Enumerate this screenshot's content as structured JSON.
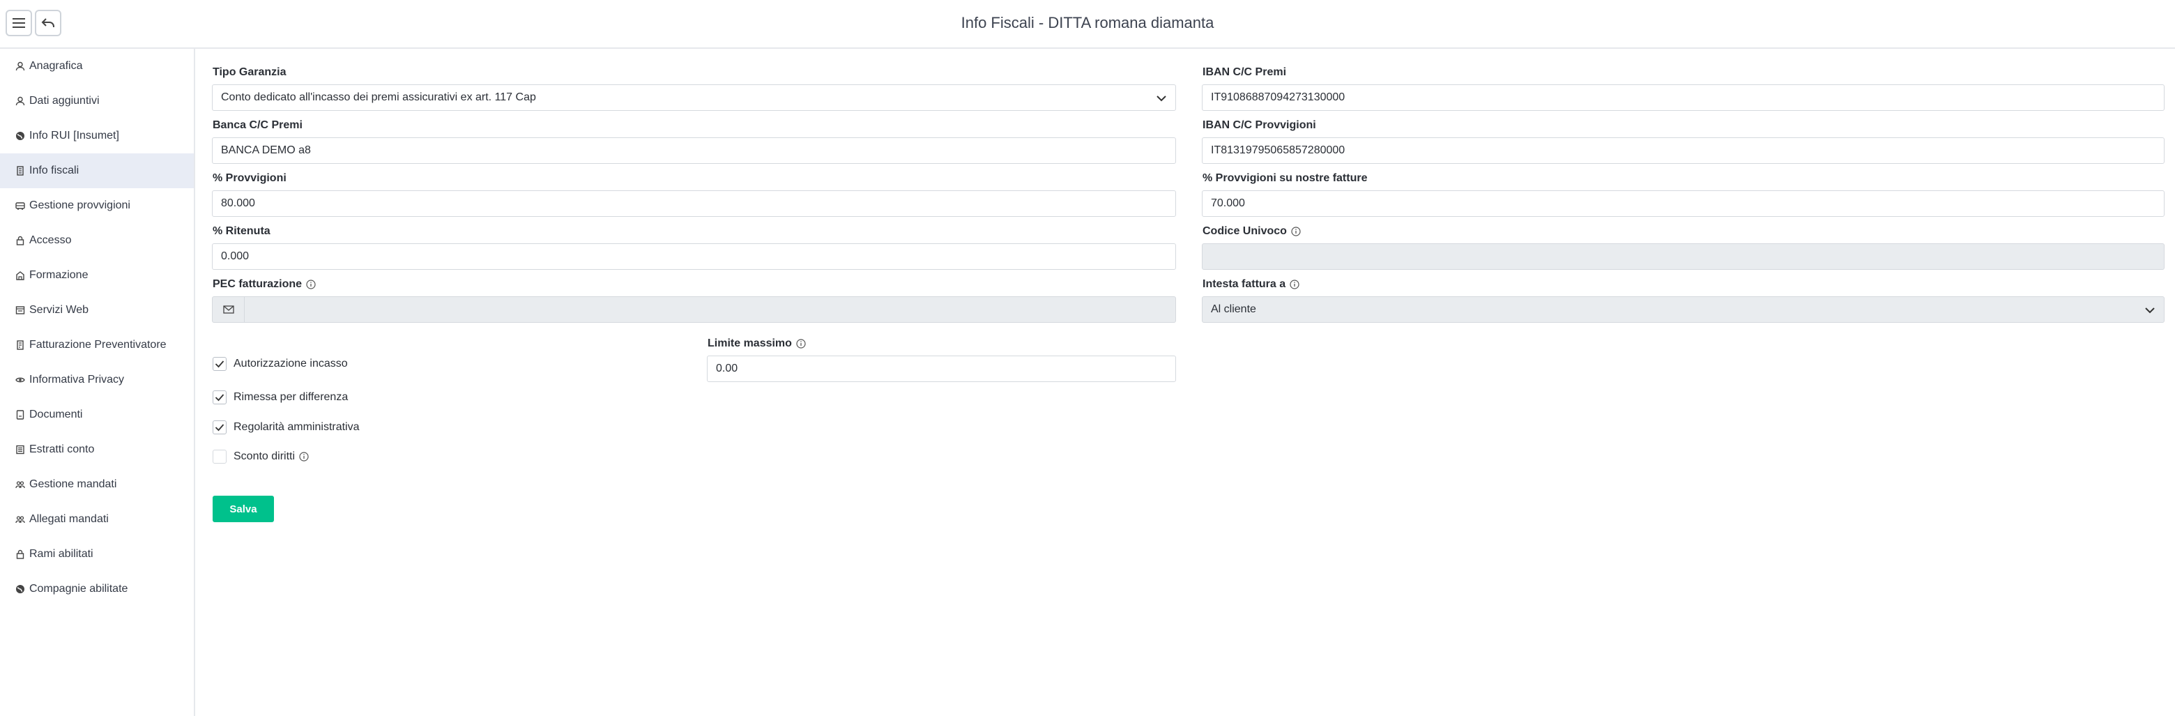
{
  "header": {
    "title": "Info Fiscali - DITTA romana diamanta",
    "menu_icon": "hamburger-icon",
    "back_icon": "undo-arrow-icon"
  },
  "sidebar": {
    "items": [
      {
        "label": "Anagrafica",
        "icon": "user-icon"
      },
      {
        "label": "Dati aggiuntivi",
        "icon": "user-icon"
      },
      {
        "label": "Info RUI [Insumet]",
        "icon": "globe-icon"
      },
      {
        "label": "Info fiscali",
        "icon": "document-icon",
        "active": true
      },
      {
        "label": "Gestione provvigioni",
        "icon": "bus-icon"
      },
      {
        "label": "Accesso",
        "icon": "lock-icon"
      },
      {
        "label": "Formazione",
        "icon": "graduation-icon"
      },
      {
        "label": "Servizi Web",
        "icon": "server-icon"
      },
      {
        "label": "Fatturazione Preventivatore",
        "icon": "document-icon"
      },
      {
        "label": "Informativa Privacy",
        "icon": "eye-icon"
      },
      {
        "label": "Documenti",
        "icon": "file-icon"
      },
      {
        "label": "Estratti conto",
        "icon": "list-icon"
      },
      {
        "label": "Gestione mandati",
        "icon": "users-icon"
      },
      {
        "label": "Allegati mandati",
        "icon": "users-icon"
      },
      {
        "label": "Rami abilitati",
        "icon": "lock-icon"
      },
      {
        "label": "Compagnie abilitate",
        "icon": "globe-icon"
      }
    ]
  },
  "form": {
    "tipo_garanzia": {
      "label": "Tipo Garanzia",
      "value": "Conto dedicato all'incasso dei premi assicurativi ex art. 117 Cap"
    },
    "iban_premi": {
      "label": "IBAN C/C Premi",
      "value": "IT91086887094273130000"
    },
    "banca_premi": {
      "label": "Banca C/C Premi",
      "value": "BANCA DEMO a8"
    },
    "iban_provvigioni": {
      "label": "IBAN C/C Provvigioni",
      "value": "IT81319795065857280000"
    },
    "provvigioni": {
      "label": "% Provvigioni",
      "value": "80.000"
    },
    "provvigioni_fatture": {
      "label": "% Provvigioni su nostre fatture",
      "value": "70.000"
    },
    "ritenuta": {
      "label": "% Ritenuta",
      "value": "0.000"
    },
    "codice_univoco": {
      "label": "Codice Univoco",
      "value": ""
    },
    "pec": {
      "label": "PEC fatturazione",
      "value": ""
    },
    "intesta_fattura": {
      "label": "Intesta fattura a",
      "value": "Al cliente"
    },
    "limite_massimo": {
      "label": "Limite massimo",
      "value": "0.00"
    },
    "checks": [
      {
        "label": "Autorizzazione incasso",
        "checked": true
      },
      {
        "label": "Rimessa per differenza",
        "checked": true
      },
      {
        "label": "Regolarità amministrativa",
        "checked": true
      },
      {
        "label": "Sconto diritti",
        "checked": false
      }
    ],
    "save_label": "Salva"
  },
  "colors": {
    "accent": "#00c18c",
    "active_bg": "#e8ecf5",
    "disabled_bg": "#e9ecef"
  }
}
